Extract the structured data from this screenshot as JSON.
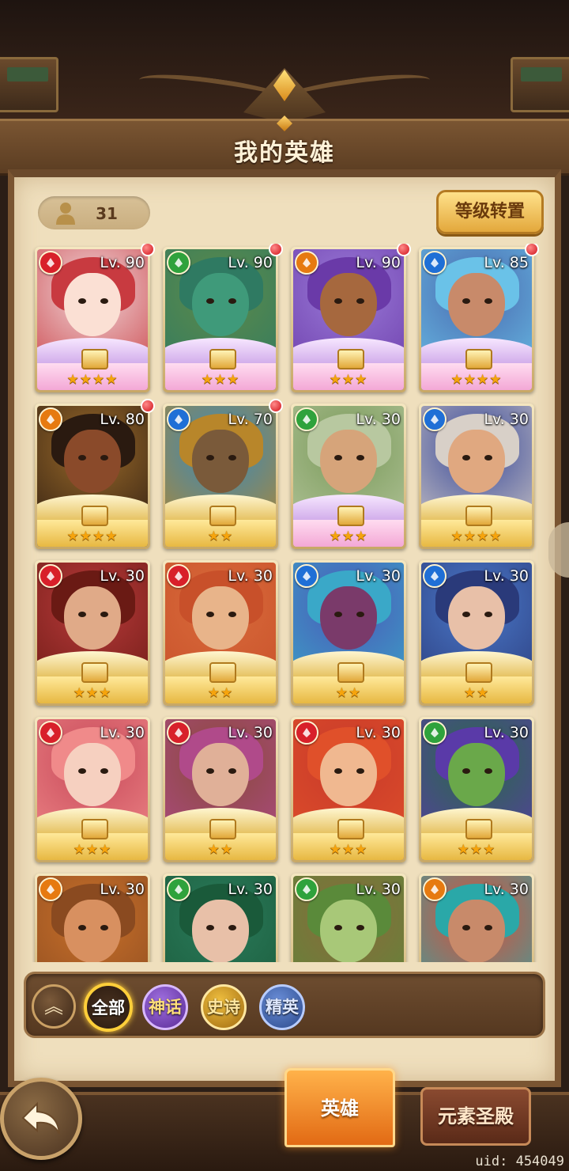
{
  "header": {
    "title": "我的英雄"
  },
  "hero_count": "31",
  "level_reset_label": "等级转置",
  "element_colors": {
    "fire": "#d8202a",
    "wind": "#2fa23c",
    "earth": "#e67a10",
    "water": "#1f6fd6"
  },
  "heroes": [
    {
      "level": "Lv. 90",
      "element": "fire",
      "stars": "★★★★",
      "stars_count": 4,
      "rarity": "mythic",
      "alert": true,
      "palette": [
        "#f0d6d8",
        "#c83a40",
        "#fbe0d4"
      ]
    },
    {
      "level": "Lv. 90",
      "element": "wind",
      "stars": "★★★",
      "stars_count": 3,
      "rarity": "mythic",
      "alert": true,
      "palette": [
        "#5d8a4a",
        "#2f7a62",
        "#3f9a7a"
      ]
    },
    {
      "level": "Lv. 90",
      "element": "earth",
      "stars": "★★★",
      "stars_count": 3,
      "rarity": "mythic",
      "alert": true,
      "palette": [
        "#9a7ad8",
        "#6a3aa8",
        "#a6683e"
      ]
    },
    {
      "level": "Lv. 85",
      "element": "water",
      "stars": "★★★★",
      "stars_count": 4,
      "rarity": "mythic",
      "alert": true,
      "palette": [
        "#4a6ab0",
        "#6ac2e8",
        "#c88a6a"
      ]
    },
    {
      "level": "Lv. 80",
      "element": "earth",
      "stars": "★★★★",
      "stars_count": 4,
      "rarity": "epic",
      "alert": true,
      "palette": [
        "#9a6a2a",
        "#2a1a10",
        "#8a4a2a"
      ]
    },
    {
      "level": "Lv. 70",
      "element": "water",
      "stars": "★★",
      "stars_count": 2,
      "rarity": "epic",
      "alert": true,
      "palette": [
        "#3a8ab8",
        "#b8862a",
        "#7a5a3a"
      ]
    },
    {
      "level": "Lv. 30",
      "element": "wind",
      "stars": "★★★",
      "stars_count": 3,
      "rarity": "mythic",
      "alert": false,
      "palette": [
        "#7a9a5a",
        "#b8c8a0",
        "#d6a47a"
      ]
    },
    {
      "level": "Lv. 30",
      "element": "water",
      "stars": "★★★★",
      "stars_count": 4,
      "rarity": "epic",
      "alert": false,
      "palette": [
        "#3a4a9a",
        "#d8d0c8",
        "#e0a880"
      ]
    },
    {
      "level": "Lv. 30",
      "element": "fire",
      "stars": "★★★",
      "stars_count": 3,
      "rarity": "epic",
      "alert": false,
      "palette": [
        "#b83a3a",
        "#6a1a14",
        "#e0aa88"
      ]
    },
    {
      "level": "Lv. 30",
      "element": "fire",
      "stars": "★★",
      "stars_count": 2,
      "rarity": "epic",
      "alert": false,
      "palette": [
        "#d86a3a",
        "#c8502a",
        "#e8b48a"
      ]
    },
    {
      "level": "Lv. 30",
      "element": "water",
      "stars": "★★",
      "stars_count": 2,
      "rarity": "epic",
      "alert": false,
      "palette": [
        "#4a5ab8",
        "#3aa8c8",
        "#7a3a6a"
      ]
    },
    {
      "level": "Lv. 30",
      "element": "water",
      "stars": "★★",
      "stars_count": 2,
      "rarity": "epic",
      "alert": false,
      "palette": [
        "#4a78c8",
        "#2a3a7a",
        "#e8c0a8"
      ]
    },
    {
      "level": "Lv. 30",
      "element": "fire",
      "stars": "★★★",
      "stars_count": 3,
      "rarity": "epic",
      "alert": false,
      "palette": [
        "#c84a5a",
        "#f08a8a",
        "#f6d0c0"
      ]
    },
    {
      "level": "Lv. 30",
      "element": "fire",
      "stars": "★★",
      "stars_count": 2,
      "rarity": "epic",
      "alert": false,
      "palette": [
        "#8a4a3a",
        "#b04a8a",
        "#e0b098"
      ]
    },
    {
      "level": "Lv. 30",
      "element": "fire",
      "stars": "★★★",
      "stars_count": 3,
      "rarity": "epic",
      "alert": false,
      "palette": [
        "#c83a2a",
        "#e0502a",
        "#f0b890"
      ]
    },
    {
      "level": "Lv. 30",
      "element": "wind",
      "stars": "★★★",
      "stars_count": 3,
      "rarity": "epic",
      "alert": false,
      "palette": [
        "#2a6a4a",
        "#5a3aa8",
        "#6aa84a"
      ]
    },
    {
      "level": "Lv. 30",
      "element": "earth",
      "stars": "",
      "stars_count": 0,
      "rarity": "epic",
      "alert": false,
      "palette": [
        "#c8702a",
        "#8a4a20",
        "#d89060"
      ]
    },
    {
      "level": "Lv. 30",
      "element": "wind",
      "stars": "",
      "stars_count": 0,
      "rarity": "epic",
      "alert": false,
      "palette": [
        "#2a7a5a",
        "#1a5a3a",
        "#e8c0a8"
      ]
    },
    {
      "level": "Lv. 30",
      "element": "wind",
      "stars": "",
      "stars_count": 0,
      "rarity": "epic",
      "alert": false,
      "palette": [
        "#8a6a3a",
        "#5a8a3a",
        "#a8c878"
      ]
    },
    {
      "level": "Lv. 30",
      "element": "earth",
      "stars": "",
      "stars_count": 0,
      "rarity": "epic",
      "alert": false,
      "palette": [
        "#d8503a",
        "#2aa8a8",
        "#c88a6a"
      ]
    }
  ],
  "filters": {
    "collapse": "︽",
    "all": "全部",
    "mythic": "神话",
    "epic": "史诗",
    "elite": "精英"
  },
  "tabs": {
    "hero": "英雄",
    "element_temple": "元素圣殿"
  },
  "uid": "uid: 454049"
}
